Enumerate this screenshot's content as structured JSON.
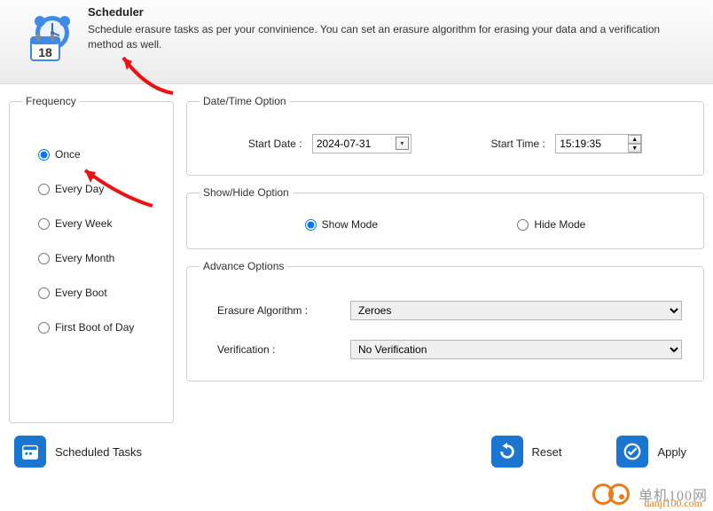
{
  "header": {
    "title": "Scheduler",
    "description": "Schedule erasure tasks as per your convinience. You can set an erasure algorithm for erasing your data and a verification method as well.",
    "icon_day": "18"
  },
  "frequency": {
    "legend": "Frequency",
    "options": [
      {
        "label": "Once",
        "checked": true
      },
      {
        "label": "Every Day",
        "checked": false
      },
      {
        "label": "Every Week",
        "checked": false
      },
      {
        "label": "Every Month",
        "checked": false
      },
      {
        "label": "Every Boot",
        "checked": false
      },
      {
        "label": "First Boot of Day",
        "checked": false
      }
    ]
  },
  "datetime": {
    "legend": "Date/Time Option",
    "start_date_label": "Start Date :",
    "start_date_value": "2024-07-31",
    "start_time_label": "Start Time :",
    "start_time_value": "15:19:35"
  },
  "showhide": {
    "legend": "Show/Hide Option",
    "show_label": "Show Mode",
    "hide_label": "Hide Mode",
    "selected": "show"
  },
  "advance": {
    "legend": "Advance Options",
    "erasure_label": "Erasure Algorithm :",
    "erasure_value": "Zeroes",
    "verification_label": "Verification :",
    "verification_value": "No Verification"
  },
  "footer": {
    "scheduled_tasks": "Scheduled Tasks",
    "reset": "Reset",
    "apply": "Apply"
  },
  "watermark": {
    "text": "单机100网",
    "domain": "danji100.com"
  }
}
